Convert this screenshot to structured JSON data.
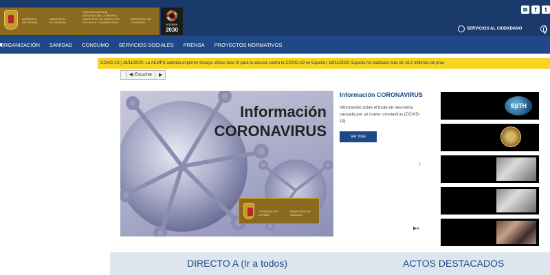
{
  "header": {
    "gov_badge": {
      "text_1": "GOBIERNO DE ESPAÑA",
      "text_2": "MINISTERIO DE SANIDAD",
      "text_3": "VICEPRESIDENCIA SEGUNDA DEL GOBIERNO MINISTERIO DE DERECHOS SOCIALES Y AGENDA 2030",
      "text_4": "MINISTERIO DE CONSUMO"
    },
    "agenda": {
      "label": "AGENDA",
      "year": "2030"
    },
    "social": [
      "rss-icon",
      "facebook-icon",
      "twitter-icon"
    ],
    "citizen_services": "SERVICIOS AL CIUDADANO"
  },
  "nav": {
    "items": [
      "ORGANIZACIÓN",
      "SANIDAD",
      "CONSUMO",
      "SERVICIOS SOCIALES",
      "PRENSA",
      "PROYECTOS NORMATIVOS"
    ]
  },
  "ticker": {
    "text": "COVID-19  |  19/11/2020: La AEMPS autoriza el primer ensayo clínico fase III para la vacuna contra la COVID-19 en España  |  18/11/2020: España ha realizado más de 16,2 millones de prue"
  },
  "listen": {
    "label": "Escuchar"
  },
  "hero": {
    "title_line1": "Información",
    "title_line2": "CORONAVIRUS",
    "gov_text_1": "GOBIERNO DE ESPAÑA",
    "gov_text_2": "MINISTERIO DE SANIDAD"
  },
  "info": {
    "title": "Información CORONAVIRUS",
    "description": "Información sobre el brote de neumonía causada por un nuevo coronavirus (COVID-19)",
    "button": "Ver más"
  },
  "thumbs": {
    "spth_label": "SpTH"
  },
  "controls": {
    "next": "›",
    "pause": "▶⏸"
  },
  "bottom": {
    "directo": "DIRECTO A (Ir a todos)",
    "actos": "ACTOS DESTACADOS"
  },
  "colors": {
    "header_bg": "#1a3a6b",
    "nav_bg": "#1e4886",
    "ticker_bg": "#f6d623",
    "gold": "#8a6a1e"
  }
}
